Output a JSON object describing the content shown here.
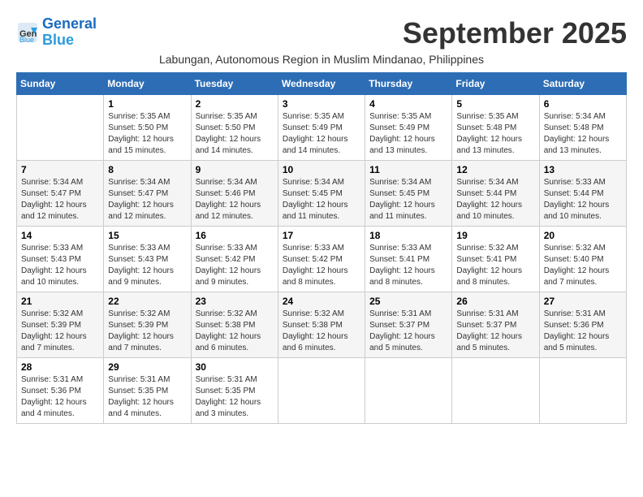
{
  "header": {
    "logo_line1": "General",
    "logo_line2": "Blue",
    "month_year": "September 2025",
    "location": "Labungan, Autonomous Region in Muslim Mindanao, Philippines"
  },
  "days_of_week": [
    "Sunday",
    "Monday",
    "Tuesday",
    "Wednesday",
    "Thursday",
    "Friday",
    "Saturday"
  ],
  "weeks": [
    [
      {
        "day": "",
        "info": ""
      },
      {
        "day": "1",
        "info": "Sunrise: 5:35 AM\nSunset: 5:50 PM\nDaylight: 12 hours\nand 15 minutes."
      },
      {
        "day": "2",
        "info": "Sunrise: 5:35 AM\nSunset: 5:50 PM\nDaylight: 12 hours\nand 14 minutes."
      },
      {
        "day": "3",
        "info": "Sunrise: 5:35 AM\nSunset: 5:49 PM\nDaylight: 12 hours\nand 14 minutes."
      },
      {
        "day": "4",
        "info": "Sunrise: 5:35 AM\nSunset: 5:49 PM\nDaylight: 12 hours\nand 13 minutes."
      },
      {
        "day": "5",
        "info": "Sunrise: 5:35 AM\nSunset: 5:48 PM\nDaylight: 12 hours\nand 13 minutes."
      },
      {
        "day": "6",
        "info": "Sunrise: 5:34 AM\nSunset: 5:48 PM\nDaylight: 12 hours\nand 13 minutes."
      }
    ],
    [
      {
        "day": "7",
        "info": "Sunrise: 5:34 AM\nSunset: 5:47 PM\nDaylight: 12 hours\nand 12 minutes."
      },
      {
        "day": "8",
        "info": "Sunrise: 5:34 AM\nSunset: 5:47 PM\nDaylight: 12 hours\nand 12 minutes."
      },
      {
        "day": "9",
        "info": "Sunrise: 5:34 AM\nSunset: 5:46 PM\nDaylight: 12 hours\nand 12 minutes."
      },
      {
        "day": "10",
        "info": "Sunrise: 5:34 AM\nSunset: 5:45 PM\nDaylight: 12 hours\nand 11 minutes."
      },
      {
        "day": "11",
        "info": "Sunrise: 5:34 AM\nSunset: 5:45 PM\nDaylight: 12 hours\nand 11 minutes."
      },
      {
        "day": "12",
        "info": "Sunrise: 5:34 AM\nSunset: 5:44 PM\nDaylight: 12 hours\nand 10 minutes."
      },
      {
        "day": "13",
        "info": "Sunrise: 5:33 AM\nSunset: 5:44 PM\nDaylight: 12 hours\nand 10 minutes."
      }
    ],
    [
      {
        "day": "14",
        "info": "Sunrise: 5:33 AM\nSunset: 5:43 PM\nDaylight: 12 hours\nand 10 minutes."
      },
      {
        "day": "15",
        "info": "Sunrise: 5:33 AM\nSunset: 5:43 PM\nDaylight: 12 hours\nand 9 minutes."
      },
      {
        "day": "16",
        "info": "Sunrise: 5:33 AM\nSunset: 5:42 PM\nDaylight: 12 hours\nand 9 minutes."
      },
      {
        "day": "17",
        "info": "Sunrise: 5:33 AM\nSunset: 5:42 PM\nDaylight: 12 hours\nand 8 minutes."
      },
      {
        "day": "18",
        "info": "Sunrise: 5:33 AM\nSunset: 5:41 PM\nDaylight: 12 hours\nand 8 minutes."
      },
      {
        "day": "19",
        "info": "Sunrise: 5:32 AM\nSunset: 5:41 PM\nDaylight: 12 hours\nand 8 minutes."
      },
      {
        "day": "20",
        "info": "Sunrise: 5:32 AM\nSunset: 5:40 PM\nDaylight: 12 hours\nand 7 minutes."
      }
    ],
    [
      {
        "day": "21",
        "info": "Sunrise: 5:32 AM\nSunset: 5:39 PM\nDaylight: 12 hours\nand 7 minutes."
      },
      {
        "day": "22",
        "info": "Sunrise: 5:32 AM\nSunset: 5:39 PM\nDaylight: 12 hours\nand 7 minutes."
      },
      {
        "day": "23",
        "info": "Sunrise: 5:32 AM\nSunset: 5:38 PM\nDaylight: 12 hours\nand 6 minutes."
      },
      {
        "day": "24",
        "info": "Sunrise: 5:32 AM\nSunset: 5:38 PM\nDaylight: 12 hours\nand 6 minutes."
      },
      {
        "day": "25",
        "info": "Sunrise: 5:31 AM\nSunset: 5:37 PM\nDaylight: 12 hours\nand 5 minutes."
      },
      {
        "day": "26",
        "info": "Sunrise: 5:31 AM\nSunset: 5:37 PM\nDaylight: 12 hours\nand 5 minutes."
      },
      {
        "day": "27",
        "info": "Sunrise: 5:31 AM\nSunset: 5:36 PM\nDaylight: 12 hours\nand 5 minutes."
      }
    ],
    [
      {
        "day": "28",
        "info": "Sunrise: 5:31 AM\nSunset: 5:36 PM\nDaylight: 12 hours\nand 4 minutes."
      },
      {
        "day": "29",
        "info": "Sunrise: 5:31 AM\nSunset: 5:35 PM\nDaylight: 12 hours\nand 4 minutes."
      },
      {
        "day": "30",
        "info": "Sunrise: 5:31 AM\nSunset: 5:35 PM\nDaylight: 12 hours\nand 3 minutes."
      },
      {
        "day": "",
        "info": ""
      },
      {
        "day": "",
        "info": ""
      },
      {
        "day": "",
        "info": ""
      },
      {
        "day": "",
        "info": ""
      }
    ]
  ]
}
